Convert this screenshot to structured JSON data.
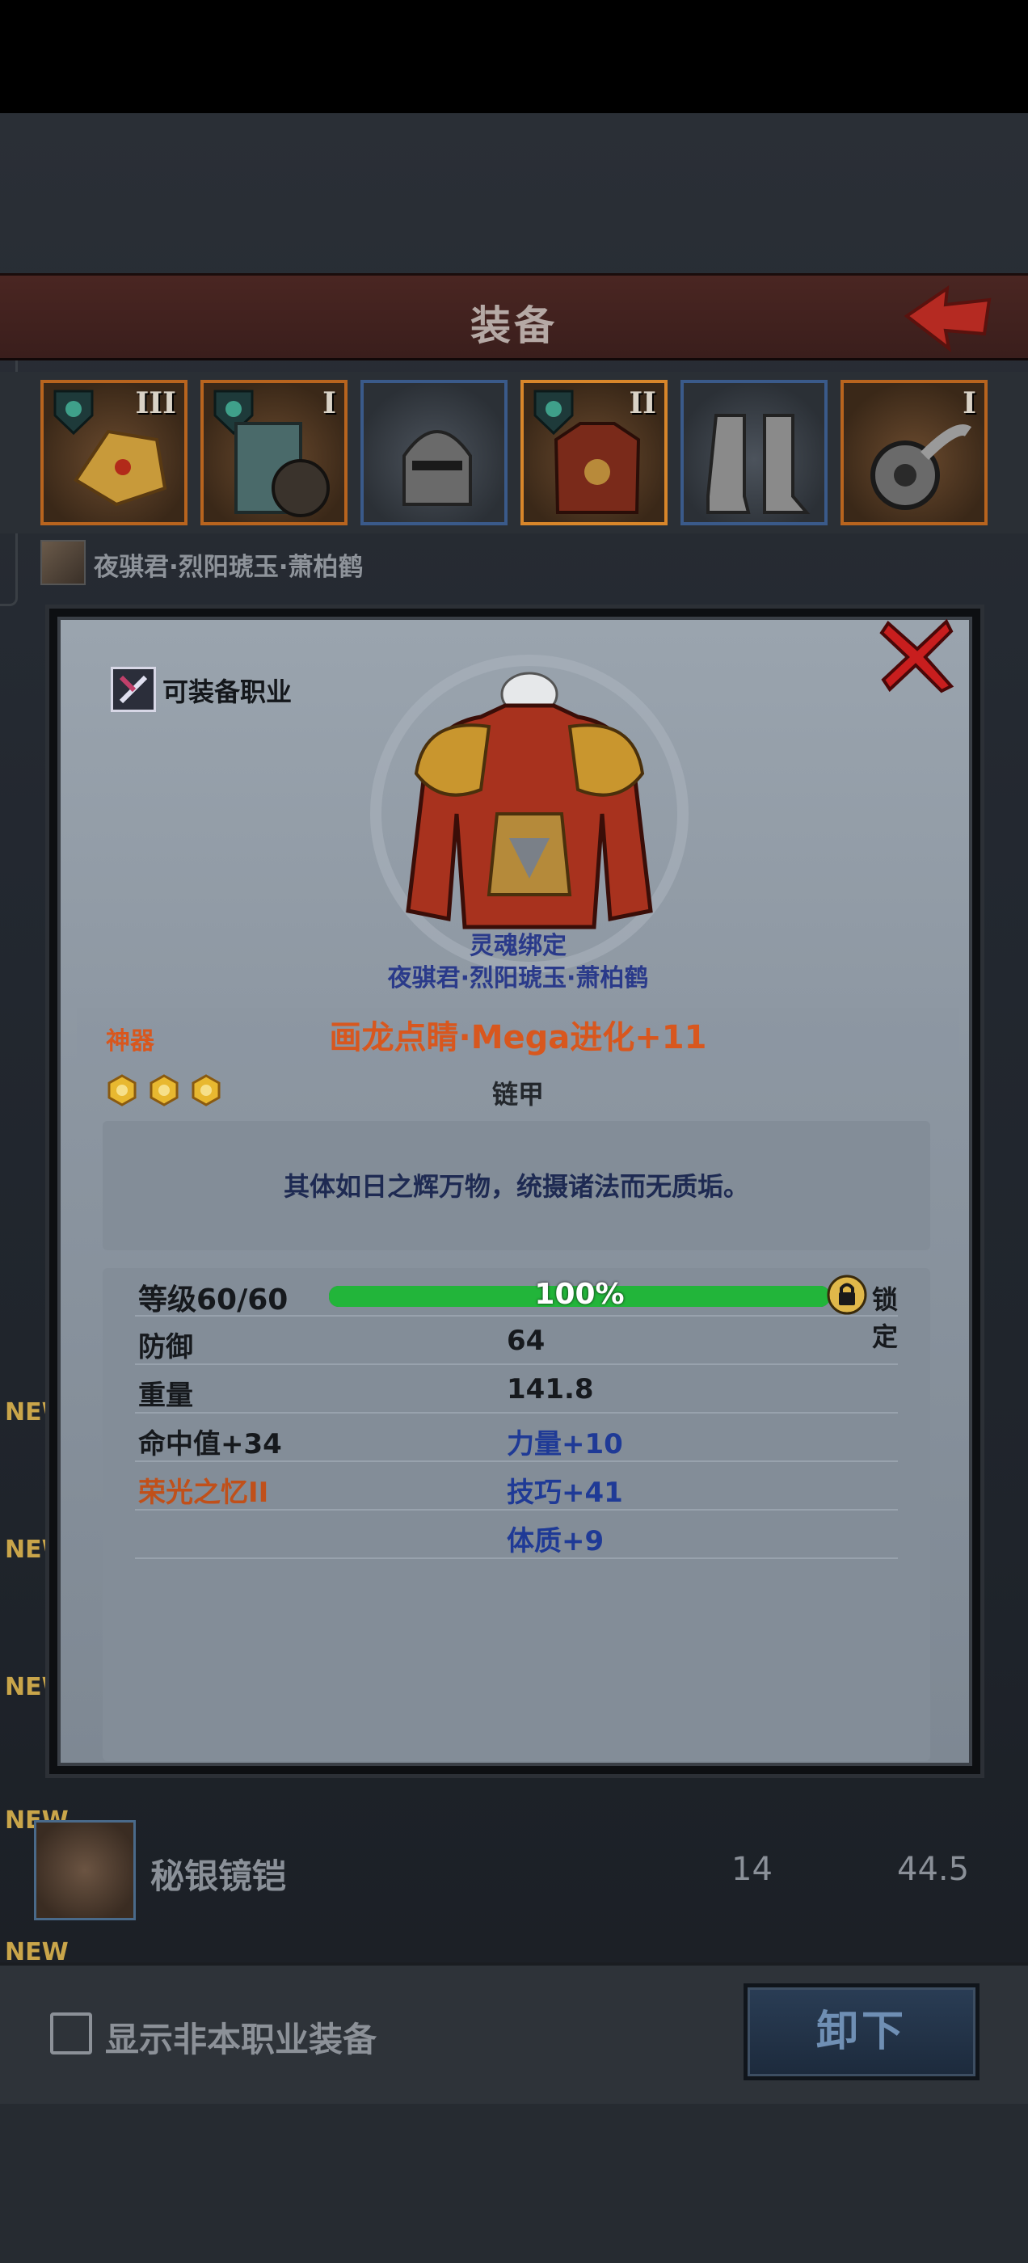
{
  "header": {
    "title": "装备"
  },
  "slots": [
    {
      "tier": "III",
      "border": "orange",
      "has_class_shield": true,
      "icon": "shoulder-armor-icon"
    },
    {
      "tier": "I",
      "border": "orange",
      "has_class_shield": true,
      "icon": "shield-icon"
    },
    {
      "tier": "",
      "border": "blue",
      "has_class_shield": false,
      "icon": "helmet-icon"
    },
    {
      "tier": "II",
      "border": "orange",
      "has_class_shield": true,
      "icon": "chest-armor-icon"
    },
    {
      "tier": "",
      "border": "blue",
      "has_class_shield": false,
      "icon": "boots-icon"
    },
    {
      "tier": "I",
      "border": "orange",
      "has_class_shield": false,
      "icon": "gauntlet-icon"
    }
  ],
  "hero": {
    "name": "夜骐君·烈阳琥玉·萧柏鹤"
  },
  "list": {
    "new_tag": "NEW",
    "visible_item": {
      "name": "秘银镜铠",
      "value1": "14",
      "value2": "44.5"
    }
  },
  "footer": {
    "checkbox_label": "显示非本职业装备",
    "unequip_label": "卸下"
  },
  "dialog": {
    "job_label": "可装备职业",
    "bind_label": "灵魂绑定",
    "owner_label": "夜骐君·烈阳琥玉·萧柏鹤",
    "rarity": "神器",
    "item_name": "画龙点睛·Mega进化+11",
    "star_count": 3,
    "item_type": "链甲",
    "description": "其体如日之辉万物，统摄诸法而无质垢。",
    "level": {
      "label": "等级60/60",
      "percent_text": "100%",
      "fill": 1.0,
      "lock_label": "锁定"
    },
    "stats": [
      {
        "left": "防御",
        "right": "64",
        "left_color": "black",
        "right_color": "black"
      },
      {
        "left": "重量",
        "right": "141.8",
        "left_color": "black",
        "right_color": "black"
      },
      {
        "left": "命中值+34",
        "right": "力量+10",
        "left_color": "black",
        "right_color": "blue"
      },
      {
        "left": "荣光之忆II",
        "right": "技巧+41",
        "left_color": "orange",
        "right_color": "blue"
      },
      {
        "left": "",
        "right": "体质+9",
        "left_color": "black",
        "right_color": "blue"
      }
    ]
  },
  "colors": {
    "accent_orange": "#d8571e",
    "stat_blue": "#1f3a96",
    "level_green": "#22b53a",
    "close_red": "#c81e1e"
  }
}
